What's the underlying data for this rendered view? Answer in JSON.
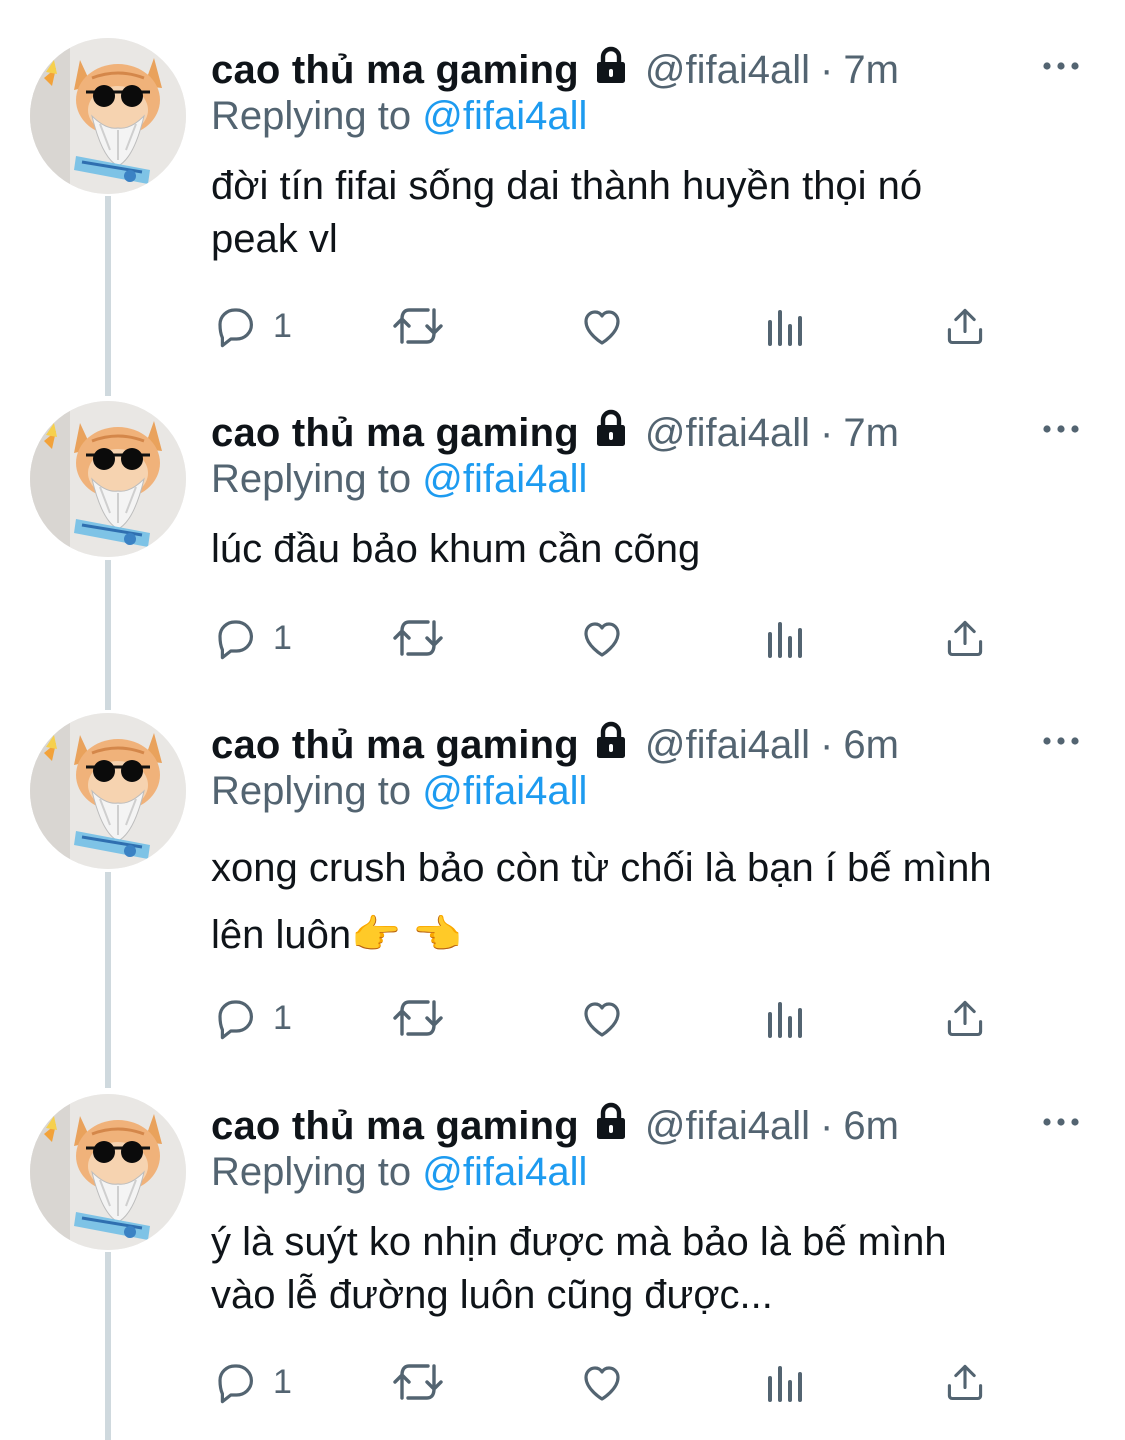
{
  "tweets": [
    {
      "name": "cao thủ ma gaming",
      "handle": "@fifai4all",
      "separator": "·",
      "time": "7m",
      "replying_label": "Replying to",
      "replying_to": "@fifai4all",
      "text": "đời tín fifai sống dai thành huyền thọi nó\npeak vl",
      "reply_count": "1"
    },
    {
      "name": "cao thủ ma gaming",
      "handle": "@fifai4all",
      "separator": "·",
      "time": "7m",
      "replying_label": "Replying to",
      "replying_to": "@fifai4all",
      "text": "lúc đầu bảo khum cần cõng",
      "reply_count": "1"
    },
    {
      "name": "cao thủ ma gaming",
      "handle": "@fifai4all",
      "separator": "·",
      "time": "6m",
      "replying_label": "Replying to",
      "replying_to": "@fifai4all",
      "text": "xong crush bảo còn từ chối là bạn í bế mình\nlên luôn👉 👈",
      "reply_count": "1"
    },
    {
      "name": "cao thủ ma gaming",
      "handle": "@fifai4all",
      "separator": "·",
      "time": "6m",
      "replying_label": "Replying to",
      "replying_to": "@fifai4all",
      "text": "ý là suýt ko nhịn được mà bảo là bế mình\nvào lễ đường luôn cũng được...",
      "reply_count": "1"
    }
  ],
  "icons": {
    "lock": "lock-icon",
    "more": "more-dots-icon",
    "reply": "reply-bubble-icon",
    "retweet": "retweet-icon",
    "like": "heart-icon",
    "views": "views-bar-chart-icon",
    "share": "share-upload-icon"
  },
  "colors": {
    "text": "#0f1419",
    "secondary": "#536471",
    "link": "#1d9bf0",
    "thread_line": "#cfd9de"
  }
}
